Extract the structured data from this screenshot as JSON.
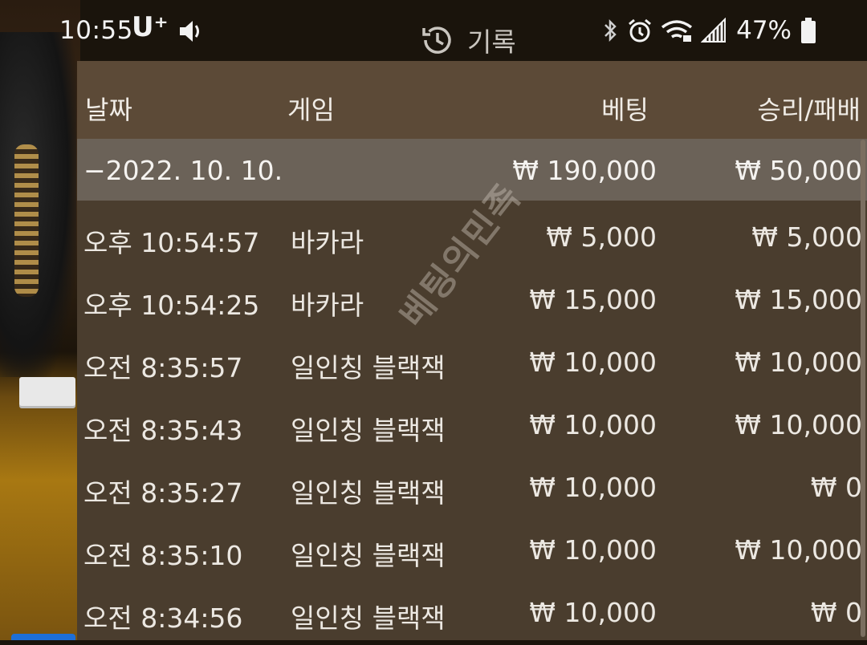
{
  "status_bar": {
    "time": "10:55",
    "carrier": "U⁺",
    "battery_percent": "47%"
  },
  "header": {
    "title": "기록",
    "icon": "history-icon"
  },
  "table": {
    "columns": {
      "date": "날짜",
      "game": "게임",
      "bet": "베팅",
      "result": "승리/패배"
    },
    "summary": {
      "date": "−2022. 10. 10.",
      "bet": "₩ 190,000",
      "result": "₩ 50,000"
    },
    "rows": [
      {
        "time": "오후 10:54:57",
        "game": "바카라",
        "bet": "₩ 5,000",
        "result": "₩ 5,000"
      },
      {
        "time": "오후 10:54:25",
        "game": "바카라",
        "bet": "₩ 15,000",
        "result": "₩ 15,000"
      },
      {
        "time": "오전 8:35:57",
        "game": "일인칭 블랙잭",
        "bet": "₩ 10,000",
        "result": "₩ 10,000"
      },
      {
        "time": "오전 8:35:43",
        "game": "일인칭 블랙잭",
        "bet": "₩ 10,000",
        "result": "₩ 10,000"
      },
      {
        "time": "오전 8:35:27",
        "game": "일인칭 블랙잭",
        "bet": "₩ 10,000",
        "result": "₩ 0"
      },
      {
        "time": "오전 8:35:10",
        "game": "일인칭 블랙잭",
        "bet": "₩ 10,000",
        "result": "₩ 10,000"
      },
      {
        "time": "오전 8:34:56",
        "game": "일인칭 블랙잭",
        "bet": "₩ 10,000",
        "result": "₩ 0"
      }
    ]
  },
  "watermark": "베팅의민족"
}
